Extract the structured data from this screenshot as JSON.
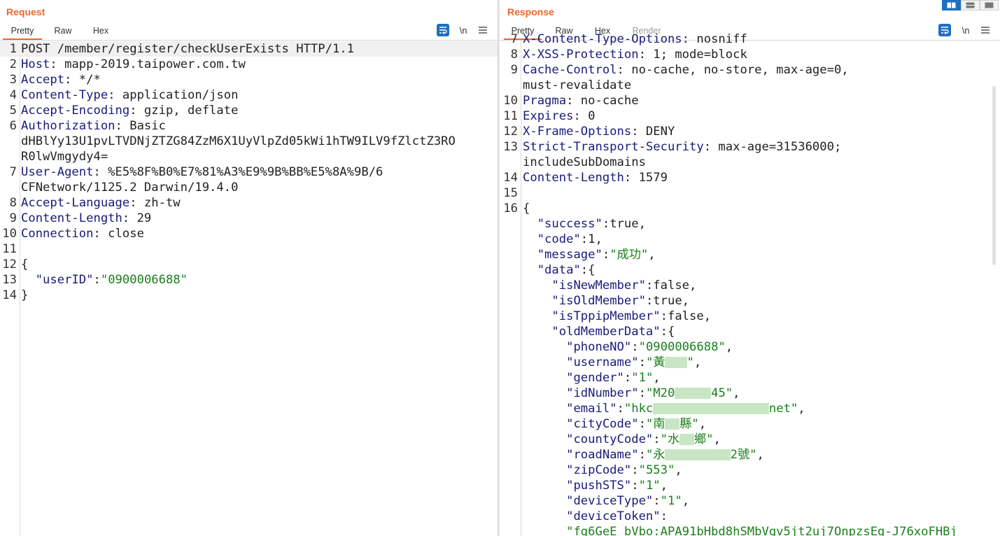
{
  "request": {
    "title": "Request",
    "tabs": [
      "Pretty",
      "Raw",
      "Hex"
    ],
    "active_tab": "Pretty",
    "toolbar": {
      "newline_label": "\\n",
      "menu_icon": "hamburger-icon",
      "wrap_icon": "wrap-icon"
    },
    "lines": [
      {
        "n": "1",
        "parts": [
          {
            "t": "POST /member/register/checkUserExists HTTP/1.1",
            "c": "plain"
          }
        ],
        "hl": true
      },
      {
        "n": "2",
        "parts": [
          {
            "t": "Host",
            "c": "key"
          },
          {
            "t": ": mapp-2019.taipower.com.tw",
            "c": "plain"
          }
        ]
      },
      {
        "n": "3",
        "parts": [
          {
            "t": "Accept",
            "c": "key"
          },
          {
            "t": ": */*",
            "c": "plain"
          }
        ]
      },
      {
        "n": "4",
        "parts": [
          {
            "t": "Content-Type",
            "c": "key"
          },
          {
            "t": ": application/json",
            "c": "plain"
          }
        ]
      },
      {
        "n": "5",
        "parts": [
          {
            "t": "Accept-Encoding",
            "c": "key"
          },
          {
            "t": ": gzip, deflate",
            "c": "plain"
          }
        ]
      },
      {
        "n": "6",
        "parts": [
          {
            "t": "Authorization",
            "c": "key"
          },
          {
            "t": ": Basic",
            "c": "plain"
          }
        ]
      },
      {
        "n": "",
        "parts": [
          {
            "t": "dHBlYy13U1pvLTVDNjZTZG84ZzM6X1UyVlpZd05kWi1hTW9ILV9fZlctZ3RO",
            "c": "plain"
          }
        ]
      },
      {
        "n": "",
        "parts": [
          {
            "t": "R0lwVmgydy4=",
            "c": "plain"
          }
        ]
      },
      {
        "n": "7",
        "parts": [
          {
            "t": "User-Agent",
            "c": "key"
          },
          {
            "t": ": %E5%8F%B0%E7%81%A3%E9%9B%BB%E5%8A%9B/6",
            "c": "plain"
          }
        ]
      },
      {
        "n": "",
        "parts": [
          {
            "t": "CFNetwork/1125.2 Darwin/19.4.0",
            "c": "plain"
          }
        ]
      },
      {
        "n": "8",
        "parts": [
          {
            "t": "Accept-Language",
            "c": "key"
          },
          {
            "t": ": zh-tw",
            "c": "plain"
          }
        ]
      },
      {
        "n": "9",
        "parts": [
          {
            "t": "Content-Length",
            "c": "key"
          },
          {
            "t": ": 29",
            "c": "plain"
          }
        ]
      },
      {
        "n": "10",
        "parts": [
          {
            "t": "Connection",
            "c": "key"
          },
          {
            "t": ": close",
            "c": "plain"
          }
        ]
      },
      {
        "n": "11",
        "parts": []
      },
      {
        "n": "12",
        "parts": [
          {
            "t": "{",
            "c": "plain"
          }
        ]
      },
      {
        "n": "13",
        "parts": [
          {
            "t": "  ",
            "c": "plain"
          },
          {
            "t": "\"userID\"",
            "c": "jkey"
          },
          {
            "t": ":",
            "c": "plain"
          },
          {
            "t": "\"0900006688\"",
            "c": "jstr"
          }
        ]
      },
      {
        "n": "14",
        "parts": [
          {
            "t": "}",
            "c": "plain"
          }
        ]
      }
    ]
  },
  "response": {
    "title": "Response",
    "tabs": [
      "Pretty",
      "Raw",
      "Hex",
      "Render"
    ],
    "active_tab": "Pretty",
    "toolbar": {
      "newline_label": "\\n",
      "menu_icon": "hamburger-icon",
      "wrap_icon": "wrap-icon"
    },
    "lines": [
      {
        "n": "7",
        "parts": [
          {
            "t": "X-Content-Type-Options",
            "c": "key"
          },
          {
            "t": ": nosniff",
            "c": "plain"
          }
        ],
        "cut": true
      },
      {
        "n": "8",
        "parts": [
          {
            "t": "X-XSS-Protection",
            "c": "key"
          },
          {
            "t": ": 1; mode=block",
            "c": "plain"
          }
        ]
      },
      {
        "n": "9",
        "parts": [
          {
            "t": "Cache-Control",
            "c": "key"
          },
          {
            "t": ": no-cache, no-store, max-age=0,",
            "c": "plain"
          }
        ]
      },
      {
        "n": "",
        "parts": [
          {
            "t": "must-revalidate",
            "c": "plain"
          }
        ]
      },
      {
        "n": "10",
        "parts": [
          {
            "t": "Pragma",
            "c": "key"
          },
          {
            "t": ": no-cache",
            "c": "plain"
          }
        ]
      },
      {
        "n": "11",
        "parts": [
          {
            "t": "Expires",
            "c": "key"
          },
          {
            "t": ": 0",
            "c": "plain"
          }
        ]
      },
      {
        "n": "12",
        "parts": [
          {
            "t": "X-Frame-Options",
            "c": "key"
          },
          {
            "t": ": DENY",
            "c": "plain"
          }
        ]
      },
      {
        "n": "13",
        "parts": [
          {
            "t": "Strict-Transport-Security",
            "c": "key"
          },
          {
            "t": ": max-age=31536000;",
            "c": "plain"
          }
        ]
      },
      {
        "n": "",
        "parts": [
          {
            "t": "includeSubDomains",
            "c": "plain"
          }
        ]
      },
      {
        "n": "14",
        "parts": [
          {
            "t": "Content-Length",
            "c": "key"
          },
          {
            "t": ": 1579",
            "c": "plain"
          }
        ]
      },
      {
        "n": "15",
        "parts": []
      },
      {
        "n": "16",
        "parts": [
          {
            "t": "{",
            "c": "plain"
          }
        ]
      },
      {
        "n": "",
        "parts": [
          {
            "t": "  ",
            "c": "plain"
          },
          {
            "t": "\"success\"",
            "c": "jkey"
          },
          {
            "t": ":true,",
            "c": "plain"
          }
        ]
      },
      {
        "n": "",
        "parts": [
          {
            "t": "  ",
            "c": "plain"
          },
          {
            "t": "\"code\"",
            "c": "jkey"
          },
          {
            "t": ":1,",
            "c": "plain"
          }
        ]
      },
      {
        "n": "",
        "parts": [
          {
            "t": "  ",
            "c": "plain"
          },
          {
            "t": "\"message\"",
            "c": "jkey"
          },
          {
            "t": ":",
            "c": "plain"
          },
          {
            "t": "\"成功\"",
            "c": "jstr"
          },
          {
            "t": ",",
            "c": "plain"
          }
        ]
      },
      {
        "n": "",
        "parts": [
          {
            "t": "  ",
            "c": "plain"
          },
          {
            "t": "\"data\"",
            "c": "jkey"
          },
          {
            "t": ":{",
            "c": "plain"
          }
        ]
      },
      {
        "n": "",
        "parts": [
          {
            "t": "    ",
            "c": "plain"
          },
          {
            "t": "\"isNewMember\"",
            "c": "jkey"
          },
          {
            "t": ":false,",
            "c": "plain"
          }
        ]
      },
      {
        "n": "",
        "parts": [
          {
            "t": "    ",
            "c": "plain"
          },
          {
            "t": "\"isOldMember\"",
            "c": "jkey"
          },
          {
            "t": ":true,",
            "c": "plain"
          }
        ]
      },
      {
        "n": "",
        "parts": [
          {
            "t": "    ",
            "c": "plain"
          },
          {
            "t": "\"isTppipMember\"",
            "c": "jkey"
          },
          {
            "t": ":false,",
            "c": "plain"
          }
        ]
      },
      {
        "n": "",
        "parts": [
          {
            "t": "    ",
            "c": "plain"
          },
          {
            "t": "\"oldMemberData\"",
            "c": "jkey"
          },
          {
            "t": ":{",
            "c": "plain"
          }
        ]
      },
      {
        "n": "",
        "parts": [
          {
            "t": "      ",
            "c": "plain"
          },
          {
            "t": "\"phoneNO\"",
            "c": "jkey"
          },
          {
            "t": ":",
            "c": "plain"
          },
          {
            "t": "\"0900006688\"",
            "c": "jstr"
          },
          {
            "t": ",",
            "c": "plain"
          }
        ]
      },
      {
        "n": "",
        "parts": [
          {
            "t": "      ",
            "c": "plain"
          },
          {
            "t": "\"username\"",
            "c": "jkey"
          },
          {
            "t": ":",
            "c": "plain"
          },
          {
            "t": "\"黃",
            "c": "jstr"
          },
          {
            "t": "   ",
            "c": "blur"
          },
          {
            "t": "\"",
            "c": "jstr"
          },
          {
            "t": ",",
            "c": "plain"
          }
        ]
      },
      {
        "n": "",
        "parts": [
          {
            "t": "      ",
            "c": "plain"
          },
          {
            "t": "\"gender\"",
            "c": "jkey"
          },
          {
            "t": ":",
            "c": "plain"
          },
          {
            "t": "\"1\"",
            "c": "jstr"
          },
          {
            "t": ",",
            "c": "plain"
          }
        ]
      },
      {
        "n": "",
        "parts": [
          {
            "t": "      ",
            "c": "plain"
          },
          {
            "t": "\"idNumber\"",
            "c": "jkey"
          },
          {
            "t": ":",
            "c": "plain"
          },
          {
            "t": "\"M20",
            "c": "jstr"
          },
          {
            "t": "     ",
            "c": "blur"
          },
          {
            "t": "45\"",
            "c": "jstr"
          },
          {
            "t": ",",
            "c": "plain"
          }
        ]
      },
      {
        "n": "",
        "parts": [
          {
            "t": "      ",
            "c": "plain"
          },
          {
            "t": "\"email\"",
            "c": "jkey"
          },
          {
            "t": ":",
            "c": "plain"
          },
          {
            "t": "\"hkc",
            "c": "jstr"
          },
          {
            "t": "                ",
            "c": "blur"
          },
          {
            "t": "net\"",
            "c": "jstr"
          },
          {
            "t": ",",
            "c": "plain"
          }
        ]
      },
      {
        "n": "",
        "parts": [
          {
            "t": "      ",
            "c": "plain"
          },
          {
            "t": "\"cityCode\"",
            "c": "jkey"
          },
          {
            "t": ":",
            "c": "plain"
          },
          {
            "t": "\"南",
            "c": "jstr"
          },
          {
            "t": "  ",
            "c": "blur"
          },
          {
            "t": "縣\"",
            "c": "jstr"
          },
          {
            "t": ",",
            "c": "plain"
          }
        ]
      },
      {
        "n": "",
        "parts": [
          {
            "t": "      ",
            "c": "plain"
          },
          {
            "t": "\"countyCode\"",
            "c": "jkey"
          },
          {
            "t": ":",
            "c": "plain"
          },
          {
            "t": "\"水",
            "c": "jstr"
          },
          {
            "t": "  ",
            "c": "blur"
          },
          {
            "t": "鄉\"",
            "c": "jstr"
          },
          {
            "t": ",",
            "c": "plain"
          }
        ]
      },
      {
        "n": "",
        "parts": [
          {
            "t": "      ",
            "c": "plain"
          },
          {
            "t": "\"roadName\"",
            "c": "jkey"
          },
          {
            "t": ":",
            "c": "plain"
          },
          {
            "t": "\"永",
            "c": "jstr"
          },
          {
            "t": "         ",
            "c": "blur"
          },
          {
            "t": "2號\"",
            "c": "jstr"
          },
          {
            "t": ",",
            "c": "plain"
          }
        ]
      },
      {
        "n": "",
        "parts": [
          {
            "t": "      ",
            "c": "plain"
          },
          {
            "t": "\"zipCode\"",
            "c": "jkey"
          },
          {
            "t": ":",
            "c": "plain"
          },
          {
            "t": "\"553\"",
            "c": "jstr"
          },
          {
            "t": ",",
            "c": "plain"
          }
        ]
      },
      {
        "n": "",
        "parts": [
          {
            "t": "      ",
            "c": "plain"
          },
          {
            "t": "\"pushSTS\"",
            "c": "jkey"
          },
          {
            "t": ":",
            "c": "plain"
          },
          {
            "t": "\"1\"",
            "c": "jstr"
          },
          {
            "t": ",",
            "c": "plain"
          }
        ]
      },
      {
        "n": "",
        "parts": [
          {
            "t": "      ",
            "c": "plain"
          },
          {
            "t": "\"deviceType\"",
            "c": "jkey"
          },
          {
            "t": ":",
            "c": "plain"
          },
          {
            "t": "\"1\"",
            "c": "jstr"
          },
          {
            "t": ",",
            "c": "plain"
          }
        ]
      },
      {
        "n": "",
        "parts": [
          {
            "t": "      ",
            "c": "plain"
          },
          {
            "t": "\"deviceToken\"",
            "c": "jkey"
          },
          {
            "t": ":",
            "c": "plain"
          }
        ]
      },
      {
        "n": "",
        "parts": [
          {
            "t": "      ",
            "c": "plain"
          },
          {
            "t": "\"fg6GeE_bVbo:APA91bHbd8hSMbVgv5jt2uj7OnpzsEg-J76xoFHBj",
            "c": "jstr"
          }
        ],
        "cut": true
      }
    ]
  },
  "layout_buttons": [
    "split-view-icon",
    "horizontal-view-icon",
    "single-view-icon"
  ],
  "colors": {
    "accent": "#ec6a2c",
    "header_key": "#1a1a7a",
    "json_string": "#1a7f1a",
    "icon_blue": "#1f6fbf"
  }
}
